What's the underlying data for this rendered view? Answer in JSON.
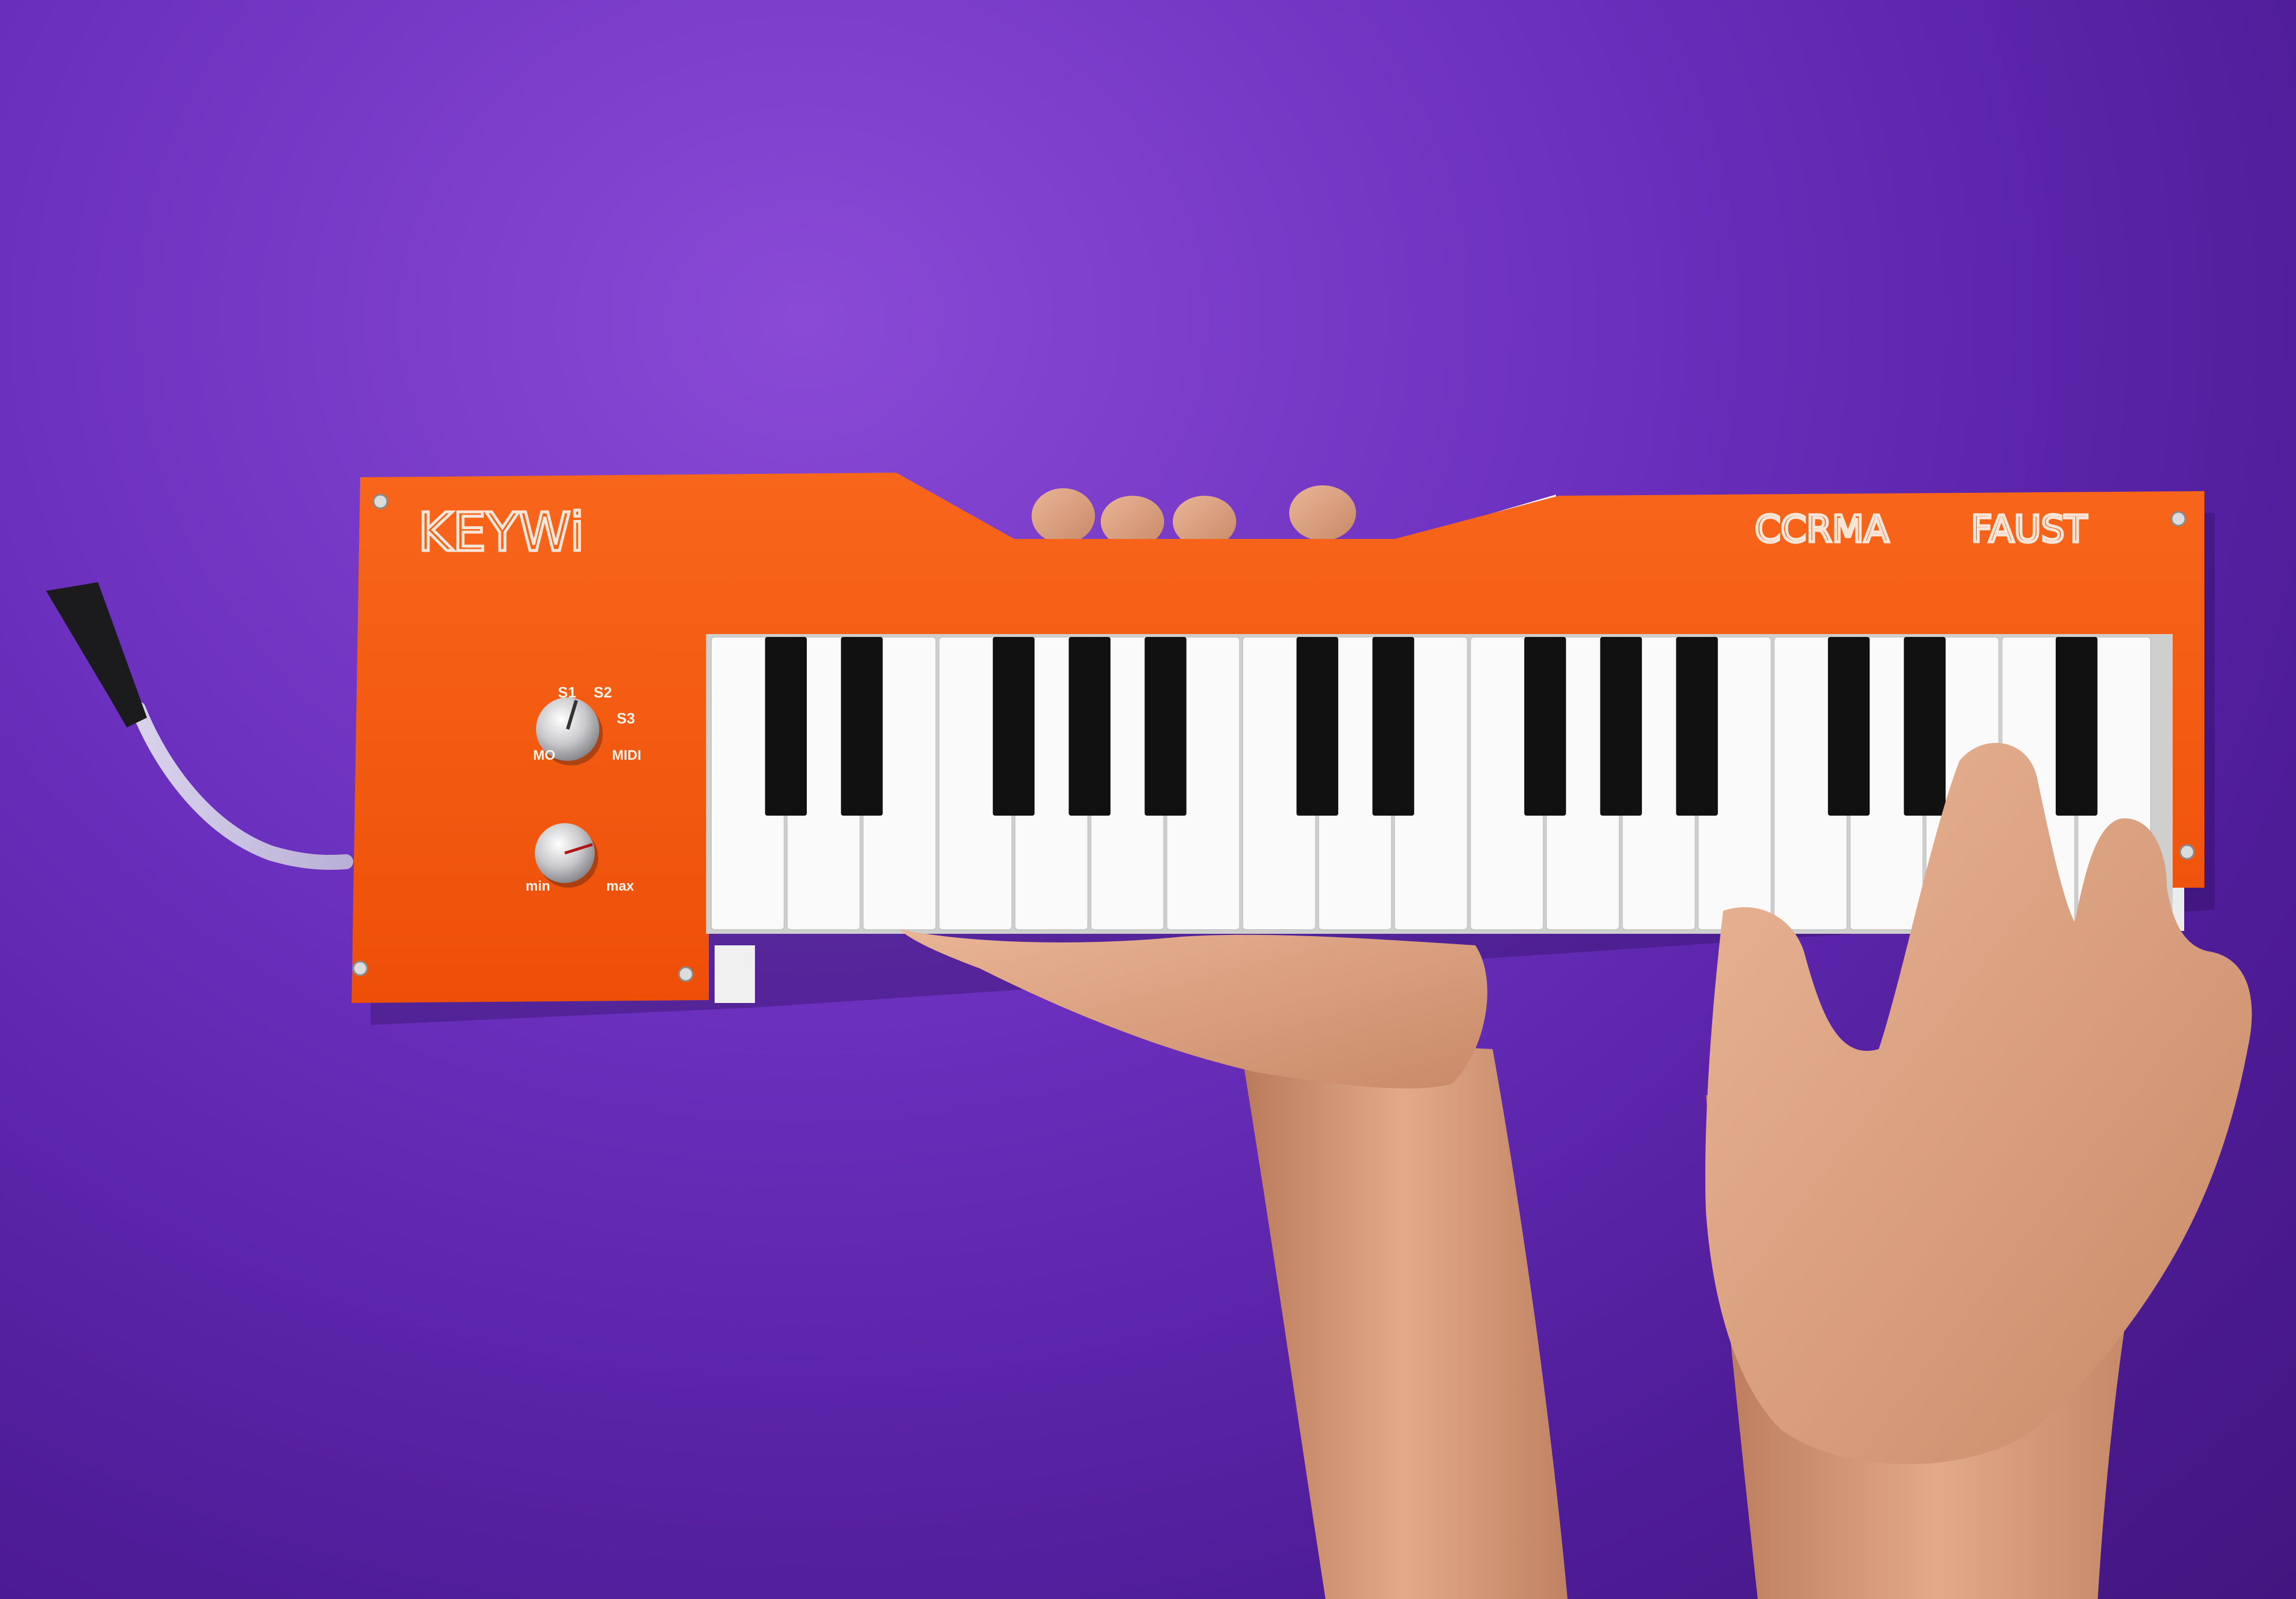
{
  "device": {
    "brand": "KEYWi",
    "logo_left": "CCRMA",
    "logo_right": "FAUST",
    "mode_knob": {
      "labels": [
        "S1",
        "S2",
        "S3",
        "MIDI",
        "MO"
      ]
    },
    "volume_knob": {
      "min_label": "min",
      "max_label": "max"
    }
  },
  "colors": {
    "background": "#5b22aa",
    "panel": "#f45a0f",
    "white_key": "#fafafa",
    "black_key": "#111111",
    "skin": "#e0a581"
  }
}
